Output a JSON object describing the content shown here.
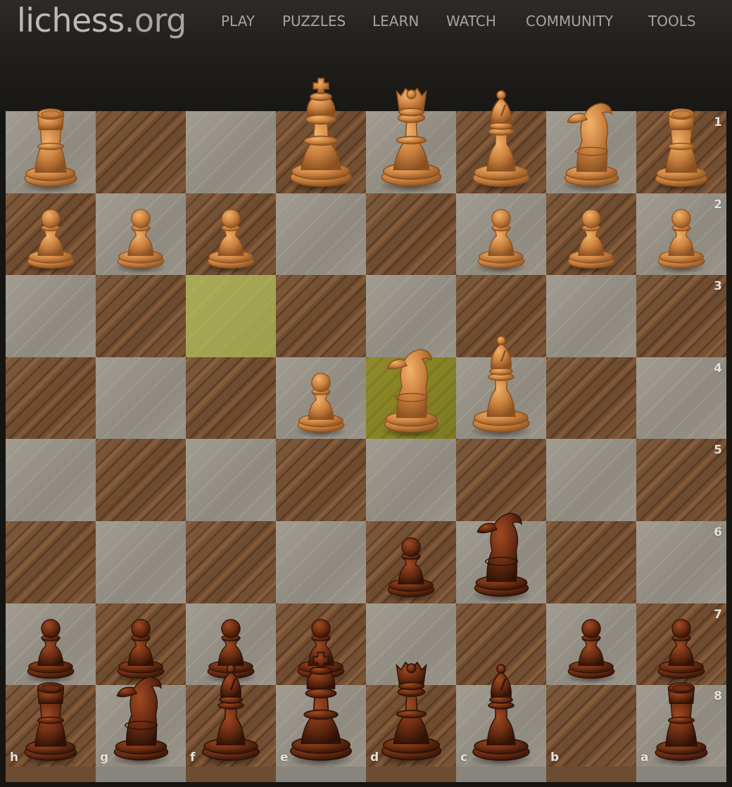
{
  "header": {
    "logo_main": "lichess",
    "logo_tld": ".org",
    "nav": [
      {
        "label": "PLAY"
      },
      {
        "label": "PUZZLES"
      },
      {
        "label": "LEARN"
      },
      {
        "label": "WATCH"
      },
      {
        "label": "COMMUNITY"
      },
      {
        "label": "TOOLS"
      }
    ]
  },
  "board": {
    "orientation": "black",
    "files_display": [
      "h",
      "g",
      "f",
      "e",
      "d",
      "c",
      "b",
      "a"
    ],
    "ranks_display": [
      "1",
      "2",
      "3",
      "4",
      "5",
      "6",
      "7",
      "8"
    ],
    "last_move": {
      "from": "f3",
      "to": "d4"
    },
    "colors": {
      "light_square": "#9a948a",
      "dark_square": "#74523a",
      "highlight_from": "#a3a552",
      "highlight_to": "#86822a",
      "white_piece": "#d9904a",
      "black_piece": "#6a2c12"
    },
    "pieces": [
      {
        "square": "h1",
        "color": "white",
        "type": "rook"
      },
      {
        "square": "e1",
        "color": "white",
        "type": "king"
      },
      {
        "square": "d1",
        "color": "white",
        "type": "queen"
      },
      {
        "square": "c1",
        "color": "white",
        "type": "bishop"
      },
      {
        "square": "b1",
        "color": "white",
        "type": "knight"
      },
      {
        "square": "a1",
        "color": "white",
        "type": "rook"
      },
      {
        "square": "h2",
        "color": "white",
        "type": "pawn"
      },
      {
        "square": "g2",
        "color": "white",
        "type": "pawn"
      },
      {
        "square": "f2",
        "color": "white",
        "type": "pawn"
      },
      {
        "square": "c2",
        "color": "white",
        "type": "pawn"
      },
      {
        "square": "b2",
        "color": "white",
        "type": "pawn"
      },
      {
        "square": "a2",
        "color": "white",
        "type": "pawn"
      },
      {
        "square": "e4",
        "color": "white",
        "type": "pawn"
      },
      {
        "square": "d4",
        "color": "white",
        "type": "knight"
      },
      {
        "square": "c4",
        "color": "white",
        "type": "bishop"
      },
      {
        "square": "d6",
        "color": "black",
        "type": "pawn"
      },
      {
        "square": "c6",
        "color": "black",
        "type": "knight"
      },
      {
        "square": "h7",
        "color": "black",
        "type": "pawn"
      },
      {
        "square": "g7",
        "color": "black",
        "type": "pawn"
      },
      {
        "square": "f7",
        "color": "black",
        "type": "pawn"
      },
      {
        "square": "e7",
        "color": "black",
        "type": "pawn"
      },
      {
        "square": "b7",
        "color": "black",
        "type": "pawn"
      },
      {
        "square": "a7",
        "color": "black",
        "type": "pawn"
      },
      {
        "square": "h8",
        "color": "black",
        "type": "rook"
      },
      {
        "square": "g8",
        "color": "black",
        "type": "knight"
      },
      {
        "square": "f8",
        "color": "black",
        "type": "bishop"
      },
      {
        "square": "e8",
        "color": "black",
        "type": "king"
      },
      {
        "square": "d8",
        "color": "black",
        "type": "queen"
      },
      {
        "square": "c8",
        "color": "black",
        "type": "bishop"
      },
      {
        "square": "a8",
        "color": "black",
        "type": "rook"
      }
    ]
  }
}
